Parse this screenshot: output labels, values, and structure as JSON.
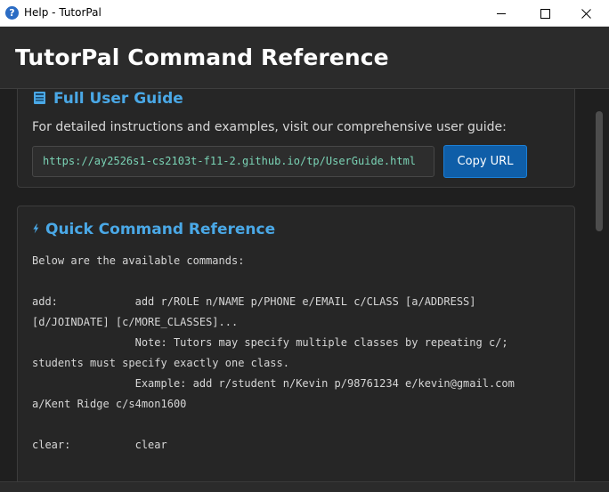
{
  "window": {
    "title": "Help - TutorPal",
    "app_icon": "question-icon",
    "controls": [
      "minimize-icon",
      "maximize-icon",
      "close-icon"
    ]
  },
  "header": {
    "title": "TutorPal Command Reference"
  },
  "user_guide": {
    "icon": "book-icon",
    "heading": "Full User Guide",
    "description": "For detailed instructions and examples, visit our comprehensive user guide:",
    "url": "https://ay2526s1-cs2103t-f11-2.github.io/tp/UserGuide.html",
    "copy_button": "Copy URL"
  },
  "quick_reference": {
    "icon": "lightning-icon",
    "heading": "Quick Command Reference",
    "text": "Below are the available commands:\n\nadd:            add r/ROLE n/NAME p/PHONE e/EMAIL c/CLASS [a/ADDRESS]\n[d/JOINDATE] [c/MORE_CLASSES]...\n                Note: Tutors may specify multiple classes by repeating c/;\nstudents must specify exactly one class.\n                Example: add r/student n/Kevin p/98761234 e/kevin@gmail.com\na/Kent Ridge c/s4mon1600\n\nclear:          clear"
  },
  "colors": {
    "accent": "#4aa8e6",
    "button": "#0f5ea8",
    "url_text": "#7ad3b5",
    "background": "#1f1f1f"
  }
}
